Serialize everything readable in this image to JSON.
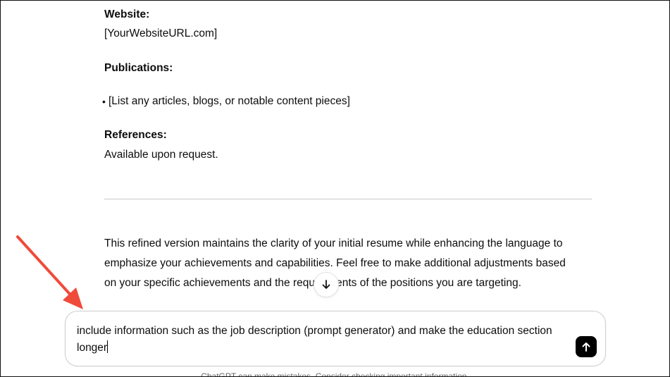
{
  "response": {
    "website_label": "Website:",
    "website_value": "[YourWebsiteURL.com]",
    "publications_label": "Publications:",
    "publications_items": [
      "[List any articles, blogs, or notable content pieces]"
    ],
    "references_label": "References:",
    "references_value": "Available upon request.",
    "closing_line1": "This refined version maintains the clarity of your initial resume while enhancing the language to",
    "closing_line2": "emphasize your achievements and capabilities. Feel free to make additional adjustments based",
    "closing_line3": "on your specific achievements and the requirements of the positions you are targeting."
  },
  "composer": {
    "line1": "include information such as the job description (prompt generator) and make the education section",
    "line2": "longer",
    "send_icon": "arrow-up-icon"
  },
  "scroll_button": {
    "icon": "arrow-down-icon"
  },
  "footer": {
    "disclaimer": "ChatGPT can make mistakes. Consider checking important information."
  },
  "annotation": {
    "arrow_color": "#f04a3a"
  }
}
